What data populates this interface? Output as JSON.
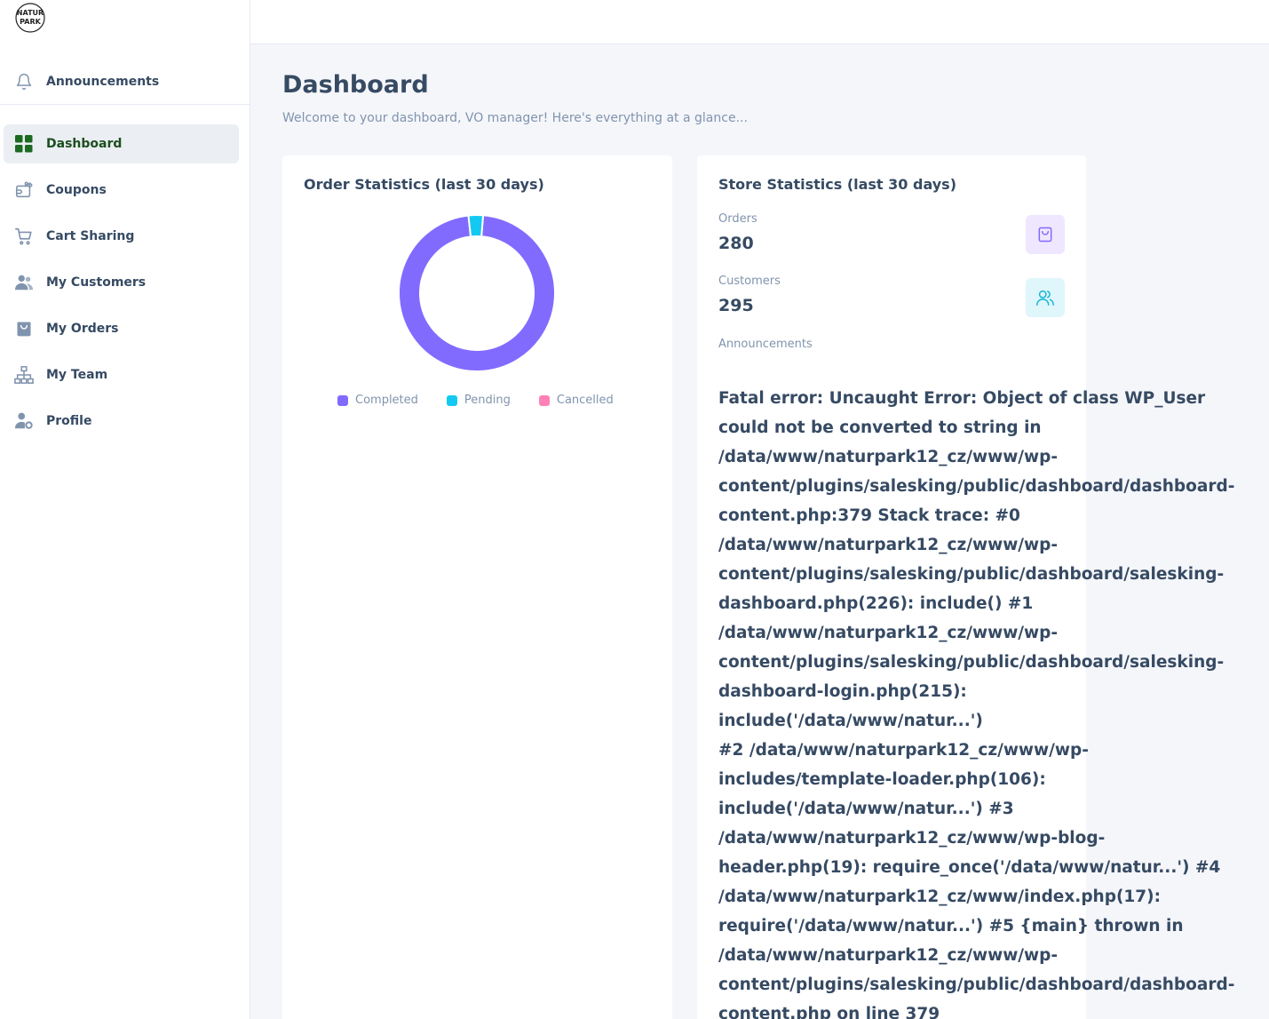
{
  "sidebar": {
    "logo_text": "NATUR PARK",
    "announcements_label": "Announcements",
    "items": [
      {
        "label": "Dashboard",
        "icon": "grid-icon",
        "active": true
      },
      {
        "label": "Coupons",
        "icon": "coupon-icon"
      },
      {
        "label": "Cart Sharing",
        "icon": "cart-icon"
      },
      {
        "label": "My Customers",
        "icon": "users-icon"
      },
      {
        "label": "My Orders",
        "icon": "bag-icon"
      },
      {
        "label": "My Team",
        "icon": "org-chart-icon"
      },
      {
        "label": "Profile",
        "icon": "user-gear-icon"
      }
    ]
  },
  "header": {
    "title": "Dashboard",
    "subtitle": "Welcome to your dashboard, VO manager! Here's everything at a glance..."
  },
  "order_stats": {
    "title": "Order Statistics (last 30 days)",
    "legend": [
      "Completed",
      "Pending",
      "Cancelled"
    ]
  },
  "store_stats": {
    "title": "Store Statistics (last 30 days)",
    "orders_label": "Orders",
    "orders_value": "280",
    "customers_label": "Customers",
    "customers_value": "295",
    "announcements_label": "Announcements"
  },
  "error_text": "Fatal error: Uncaught Error: Object of class WP_User\ncould not be converted to string in\n/data/www/naturpark12_cz/www/wp-\ncontent/plugins/salesking/public/dashboard/dashboard-\ncontent.php:379 Stack trace: #0\n/data/www/naturpark12_cz/www/wp-\ncontent/plugins/salesking/public/dashboard/salesking-\ndashboard.php(226): include() #1\n/data/www/naturpark12_cz/www/wp-\ncontent/plugins/salesking/public/dashboard/salesking-\ndashboard-login.php(215): include('/data/www/natur...')\n#2 /data/www/naturpark12_cz/www/wp-\nincludes/template-loader.php(106):\ninclude('/data/www/natur...') #3\n/data/www/naturpark12_cz/www/wp-blog-\nheader.php(19): require_once('/data/www/natur...') #4\n/data/www/naturpark12_cz/www/index.php(17):\nrequire('/data/www/natur...') #5 {main} thrown in\n/data/www/naturpark12_cz/www/wp-\ncontent/plugins/salesking/public/dashboard/dashboard-\ncontent.php on line 379",
  "chart_data": {
    "type": "pie",
    "categories": [
      "Completed",
      "Pending",
      "Cancelled"
    ],
    "values": [
      97,
      3,
      0
    ],
    "colors": [
      "#816bff",
      "#13c9f2",
      "#ff82b7"
    ]
  }
}
